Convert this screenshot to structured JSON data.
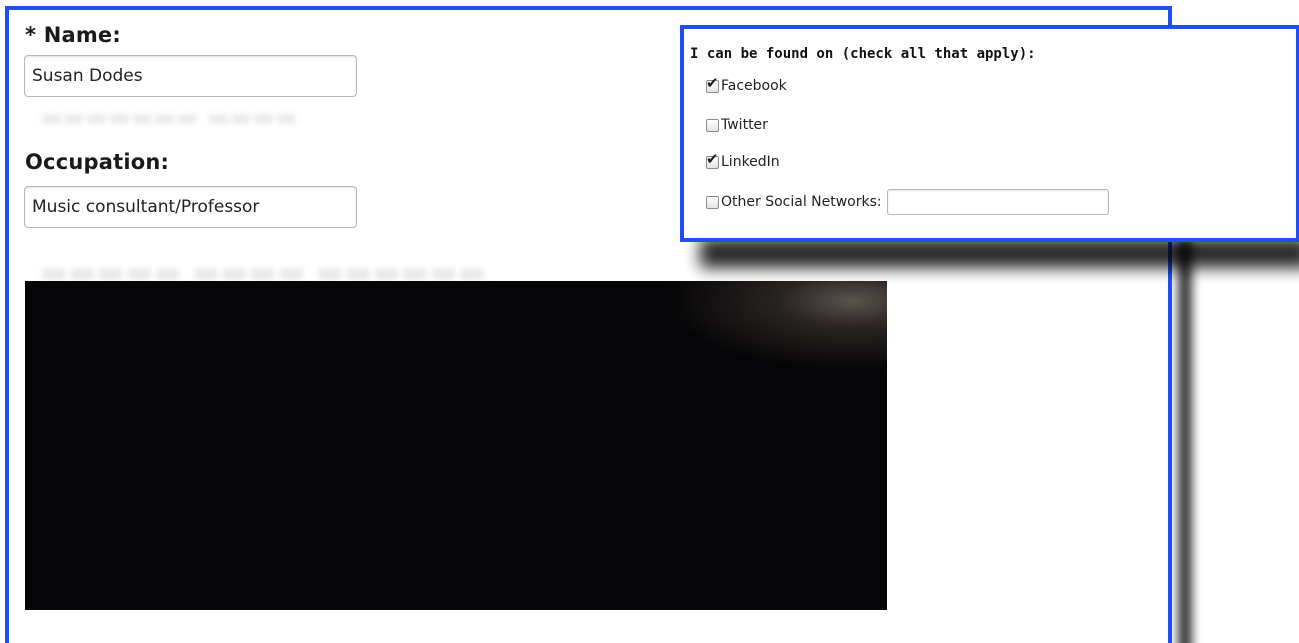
{
  "form": {
    "name": {
      "label": "* Name:",
      "value": "Susan Dodes"
    },
    "occupation": {
      "label": "Occupation:",
      "value": "Music consultant/Professor"
    }
  },
  "social_popup": {
    "heading": "I can be found on (check all that apply):",
    "options": [
      {
        "label": "Facebook",
        "checked": true
      },
      {
        "label": "Twitter",
        "checked": false
      },
      {
        "label": "LinkedIn",
        "checked": true
      },
      {
        "label": "Other Social Networks:",
        "checked": false
      }
    ],
    "other_value": ""
  },
  "colors": {
    "panel_border": "#1f4ff2",
    "video_background": "#050406"
  },
  "icons": {
    "checkmark": "checkmark-icon"
  }
}
